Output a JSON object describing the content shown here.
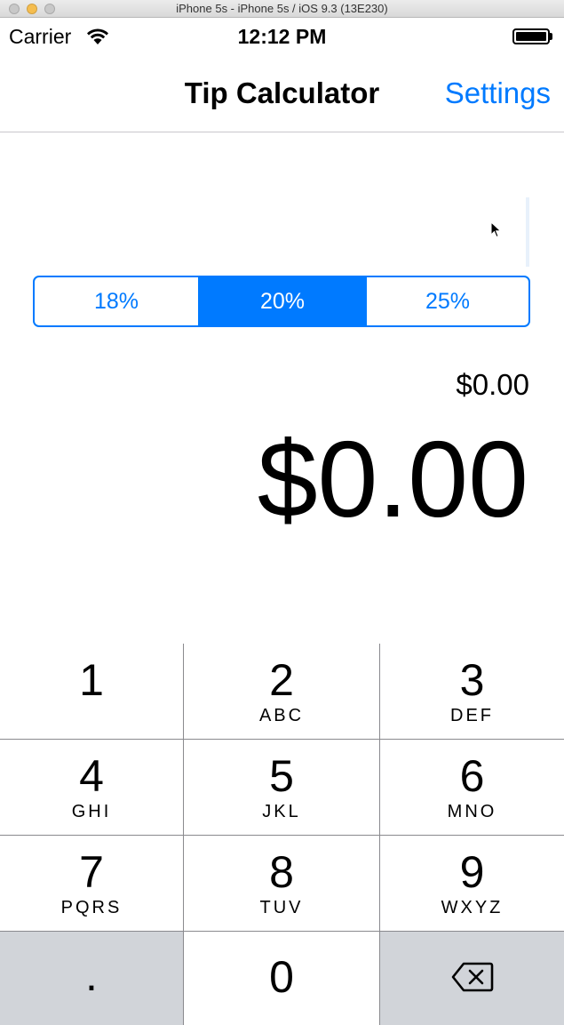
{
  "simulator": {
    "window_title": "iPhone 5s - iPhone 5s / iOS 9.3 (13E230)"
  },
  "status_bar": {
    "carrier": "Carrier",
    "time": "12:12 PM",
    "battery_level": 1.0
  },
  "nav": {
    "title": "Tip Calculator",
    "settings_label": "Settings"
  },
  "bill": {
    "value": ""
  },
  "tip_segments": [
    {
      "label": "18%",
      "selected": false
    },
    {
      "label": "20%",
      "selected": true
    },
    {
      "label": "25%",
      "selected": false
    }
  ],
  "amounts": {
    "tip": "$0.00",
    "total": "$0.00"
  },
  "keypad": {
    "keys": [
      {
        "digit": "1",
        "letters": ""
      },
      {
        "digit": "2",
        "letters": "ABC"
      },
      {
        "digit": "3",
        "letters": "DEF"
      },
      {
        "digit": "4",
        "letters": "GHI"
      },
      {
        "digit": "5",
        "letters": "JKL"
      },
      {
        "digit": "6",
        "letters": "MNO"
      },
      {
        "digit": "7",
        "letters": "PQRS"
      },
      {
        "digit": "8",
        "letters": "TUV"
      },
      {
        "digit": "9",
        "letters": "WXYZ"
      }
    ],
    "decimal": ".",
    "zero": "0",
    "delete_icon": "backspace-icon"
  },
  "colors": {
    "accent": "#007aff",
    "keypad_grey": "#d1d4d9"
  }
}
